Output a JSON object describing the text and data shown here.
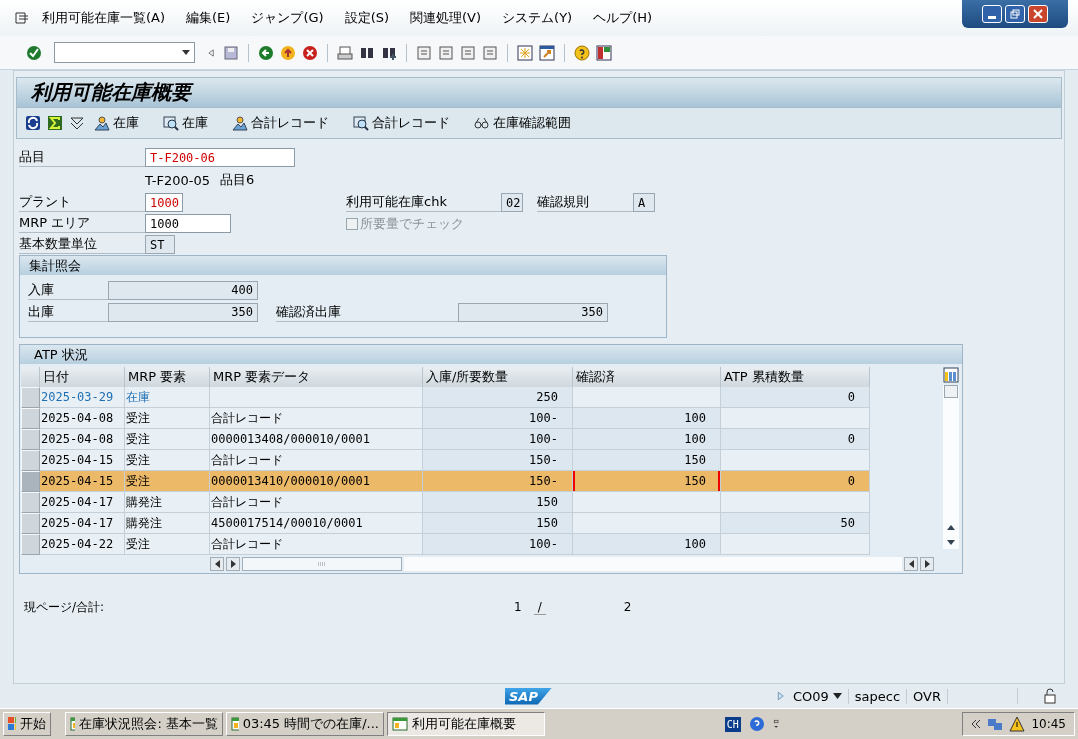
{
  "menu": [
    {
      "label": "利用可能在庫一覧(A)"
    },
    {
      "label": "編集(E)"
    },
    {
      "label": "ジャンプ(G)"
    },
    {
      "label": "設定(S)"
    },
    {
      "label": "関連処理(V)"
    },
    {
      "label": "システム(Y)"
    },
    {
      "label": "ヘルプ(H)"
    }
  ],
  "title": "利用可能在庫概要",
  "app_toolbar": [
    {
      "kind": "refresh"
    },
    {
      "kind": "sum"
    },
    {
      "kind": "filter"
    },
    {
      "kind": "stock",
      "label": "在庫"
    },
    {
      "kind": "search",
      "label": "在庫"
    },
    {
      "kind": "stock",
      "label": "合計レコード"
    },
    {
      "kind": "search",
      "label": "合計レコード"
    },
    {
      "kind": "glasses",
      "label": "在庫確認範囲"
    }
  ],
  "form": {
    "material": {
      "label": "品目",
      "value": "T-F200-06",
      "required": true
    },
    "material_text": [
      "T-F200-05",
      "品目6"
    ],
    "plant": {
      "label": "プラント",
      "value": "1000",
      "required": true
    },
    "mrp_area": {
      "label": "MRP エリア",
      "value": "1000",
      "required": false
    },
    "base_unit": {
      "label": "基本数量単位",
      "value": "ST"
    },
    "availability_check": {
      "label": "利用可能在庫chk",
      "value": "02"
    },
    "checking_rule": {
      "label": "確認規則",
      "value": "A"
    },
    "check_requirements": {
      "label": "所要量でチェック",
      "checked": false,
      "disabled": true
    }
  },
  "summary": {
    "title": "集計照会",
    "receipts": {
      "label": "入庫",
      "value": "400"
    },
    "issues": {
      "label": "出庫",
      "value": "350"
    },
    "confirmed_issues": {
      "label": "確認済出庫",
      "value": "350"
    }
  },
  "atp": {
    "title": "ATP 状況",
    "columns": [
      {
        "label": "日付",
        "kind": "text"
      },
      {
        "label": "MRP 要素",
        "kind": "text"
      },
      {
        "label": "MRP 要素データ",
        "kind": "text"
      },
      {
        "label": "入庫/所要数量",
        "kind": "quantity"
      },
      {
        "label": "確認済",
        "kind": "quantity"
      },
      {
        "label": "ATP 累積数量",
        "kind": "quantity"
      }
    ],
    "rows": [
      {
        "kind": "stock",
        "selected": false,
        "cursor": false,
        "cells": [
          "2025-03-29",
          "在庫",
          "",
          "250",
          "",
          "0"
        ]
      },
      {
        "kind": "plain",
        "selected": false,
        "cursor": false,
        "cells": [
          "2025-04-08",
          "受注",
          "合計レコード",
          "100-",
          "100",
          ""
        ]
      },
      {
        "kind": "plain",
        "selected": false,
        "cursor": false,
        "cells": [
          "2025-04-08",
          "受注",
          "0000013408/000010/0001",
          "100-",
          "100",
          "0"
        ]
      },
      {
        "kind": "plain",
        "selected": false,
        "cursor": false,
        "cells": [
          "2025-04-15",
          "受注",
          "合計レコード",
          "150-",
          "150",
          ""
        ]
      },
      {
        "kind": "plain",
        "selected": true,
        "cursor": true,
        "cells": [
          "2025-04-15",
          "受注",
          "0000013410/000010/0001",
          "150-",
          "150",
          "0"
        ]
      },
      {
        "kind": "plain",
        "selected": false,
        "cursor": false,
        "cells": [
          "2025-04-17",
          "購発注",
          "合計レコード",
          "150",
          "",
          ""
        ]
      },
      {
        "kind": "plain",
        "selected": false,
        "cursor": false,
        "cells": [
          "2025-04-17",
          "購発注",
          "4500017514/00010/0001",
          "150",
          "",
          "50"
        ]
      },
      {
        "kind": "plain",
        "selected": false,
        "cursor": false,
        "cells": [
          "2025-04-22",
          "受注",
          "合計レコード",
          "100-",
          "100",
          ""
        ]
      }
    ]
  },
  "pager": {
    "label": "現ページ/合計:",
    "current": "1",
    "separator": "/",
    "total": "2"
  },
  "status_bar": {
    "logo": "SAP",
    "transaction": "CO09",
    "server": "sapecc",
    "mode": "OVR"
  },
  "taskbar": {
    "start": "开始",
    "tasks": [
      {
        "label": "在庫状況照会: 基本一覧",
        "selected": false
      },
      {
        "label": "03:45 時間での在庫/...",
        "selected": false
      },
      {
        "label": "利用可能在庫概要",
        "selected": true
      }
    ],
    "language": "CH",
    "clock": "10:45"
  }
}
